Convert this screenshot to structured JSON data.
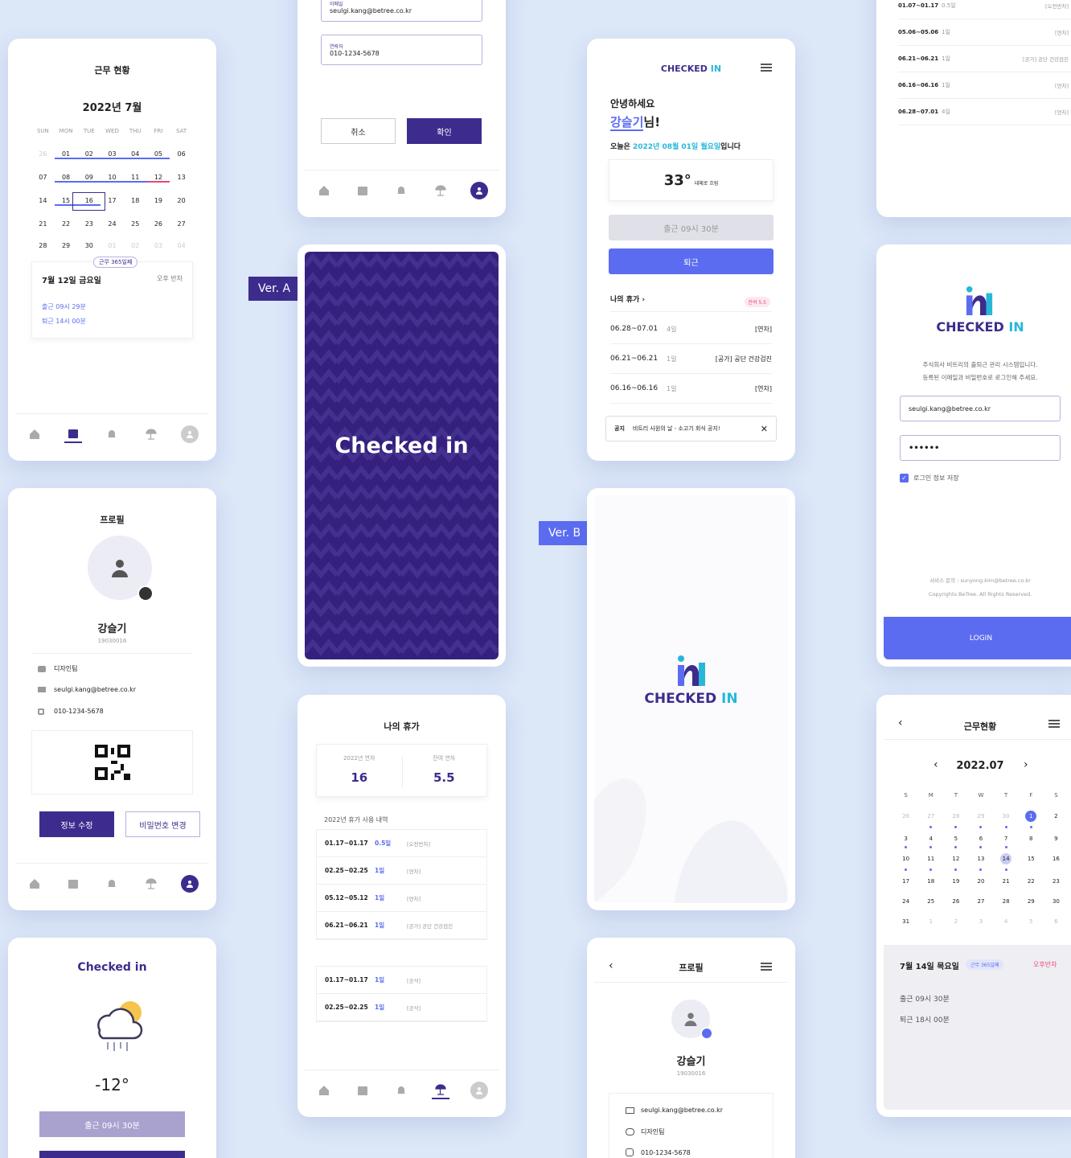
{
  "tags": {
    "ver_a": "Ver. A",
    "ver_b": "Ver. B"
  },
  "calA": {
    "title": "근무 현황",
    "month": "2022년 7월",
    "weekdays": [
      "SUN",
      "MON",
      "TUE",
      "WED",
      "THU",
      "FRI",
      "SAT"
    ],
    "days": [
      "26",
      "01",
      "02",
      "03",
      "04",
      "05",
      "06",
      "07",
      "08",
      "09",
      "10",
      "11",
      "12",
      "13",
      "14",
      "15",
      "16",
      "17",
      "18",
      "19",
      "20",
      "21",
      "22",
      "23",
      "24",
      "25",
      "26",
      "27",
      "28",
      "29",
      "30",
      "01",
      "02",
      "03",
      "04"
    ],
    "badge": "근무 365일째",
    "detail_date": "7월 12일 금요일",
    "detail_status": "오후 반차",
    "checkin": "출근 09시 29분",
    "checkout": "퇴근 14시 00분"
  },
  "profileA": {
    "title": "프로필",
    "name": "강슬기",
    "id": "19030016",
    "dept": "디자인팀",
    "email": "seulgi.kang@betree.co.kr",
    "phone": "010-1234-5678",
    "edit_btn": "정보 수정",
    "pw_btn": "비밀번호 변경"
  },
  "weatherA": {
    "logo": "Checked in",
    "temp": "-12°",
    "checkin_btn": "출근 09시 30분"
  },
  "editForm": {
    "email_label": "이메일",
    "email": "seulgi.kang@betree.co.kr",
    "phone_label": "연락처",
    "phone": "010-1234-5678",
    "cancel": "취소",
    "confirm": "확인"
  },
  "splashA": {
    "text": "Checked in"
  },
  "leaveA": {
    "title": "나의 휴가",
    "total_label": "2022년 연차",
    "total": "16",
    "remain_label": "잔여 연차",
    "remain": "5.5",
    "history_title": "2022년 휴가 사용 내역",
    "rows1": [
      {
        "date": "01.17~01.17",
        "days": "0.5일",
        "type": "[오전반차]"
      },
      {
        "date": "02.25~02.25",
        "days": "1일",
        "type": "[연차]"
      },
      {
        "date": "05.12~05.12",
        "days": "1일",
        "type": "[연차]"
      },
      {
        "date": "06.21~06.21",
        "days": "1일",
        "type": "[공가] 공단 건강검진"
      }
    ],
    "rows2": [
      {
        "date": "01.17~01.17",
        "days": "1일",
        "type": "[공석]"
      },
      {
        "date": "02.25~02.25",
        "days": "1일",
        "type": "[공석]"
      }
    ]
  },
  "homeB": {
    "logo_a": "CHECKED",
    "logo_b": "IN",
    "greet1": "안녕하세요",
    "name": "강슬기",
    "greet2": "님!",
    "today_pre": "오늘은",
    "today_date": "2022년 08월 01일 월요일",
    "today_post": "입니다",
    "temp": "33°",
    "weather": "대체로 흐림",
    "checkin": "출근 09시 30분",
    "checkout_btn": "퇴근",
    "leave_title": "나의 휴가",
    "leave_badge": "잔여 5.5",
    "leaves": [
      {
        "date": "06.28~07.01",
        "days": "4일",
        "type": "[연차]"
      },
      {
        "date": "06.21~06.21",
        "days": "1일",
        "type": "[공가] 공단 건강검진"
      },
      {
        "date": "06.16~06.16",
        "days": "1일",
        "type": "[연차]"
      }
    ],
    "notice_label": "공지",
    "notice_text": "비트리 사원의 날 - 소고기 회식 공지!"
  },
  "splashB": {
    "logo_a": "CHECKED",
    "logo_b": "IN"
  },
  "profileB": {
    "title": "프로필",
    "name": "강슬기",
    "id": "19030016",
    "email": "seulgi.kang@betree.co.kr",
    "dept": "디자인팀",
    "phone": "010-1234-5678"
  },
  "leaveListB": [
    {
      "date": "01.07~01.17",
      "days": "0.5일",
      "type": "[오전반차]"
    },
    {
      "date": "05.06~05.06",
      "days": "1일",
      "type": "[연차]"
    },
    {
      "date": "06.21~06.21",
      "days": "1일",
      "type": "[공가] 공단 건강검진"
    },
    {
      "date": "06.16~06.16",
      "days": "1일",
      "type": "[연차]"
    },
    {
      "date": "06.28~07.01",
      "days": "4일",
      "type": "[연차]"
    }
  ],
  "loginB": {
    "logo_a": "CHECKED",
    "logo_b": "IN",
    "desc1": "주식회사 비트리의 출퇴근 관리 시스템입니다.",
    "desc2": "등록된 이메일과 비밀번호로 로그인해 주세요.",
    "email": "seulgi.kang@betree.co.kr",
    "password": "••••••",
    "remember": "로그인 정보 저장",
    "service": "서비스 문의 : sunyong.kim@betree.co.kr",
    "copyright": "Copyrights BeTree. All Rights Reserved.",
    "login_btn": "LOGIN"
  },
  "calB": {
    "title": "근무현황",
    "month": "2022.07",
    "weekdays": [
      "S",
      "M",
      "T",
      "W",
      "T",
      "F",
      "S"
    ],
    "days": [
      "26",
      "27",
      "28",
      "29",
      "30",
      "1",
      "2",
      "3",
      "4",
      "5",
      "6",
      "7",
      "8",
      "9",
      "10",
      "11",
      "12",
      "13",
      "14",
      "15",
      "16",
      "17",
      "18",
      "19",
      "20",
      "21",
      "22",
      "23",
      "24",
      "25",
      "26",
      "27",
      "28",
      "29",
      "30",
      "31",
      "1",
      "2",
      "3",
      "4",
      "5",
      "6"
    ],
    "detail_date": "7월 14일 목요일",
    "badge": "근무 365일째",
    "status": "오후반차",
    "checkin": "출근 09시 30분",
    "checkout": "퇴근 18시 00분"
  },
  "colors": {
    "primary": "#3d2c8d",
    "accent": "#5b6cf0",
    "cyan": "#27b8d9",
    "pink": "#e8457a",
    "bg": "#dce7f8"
  }
}
